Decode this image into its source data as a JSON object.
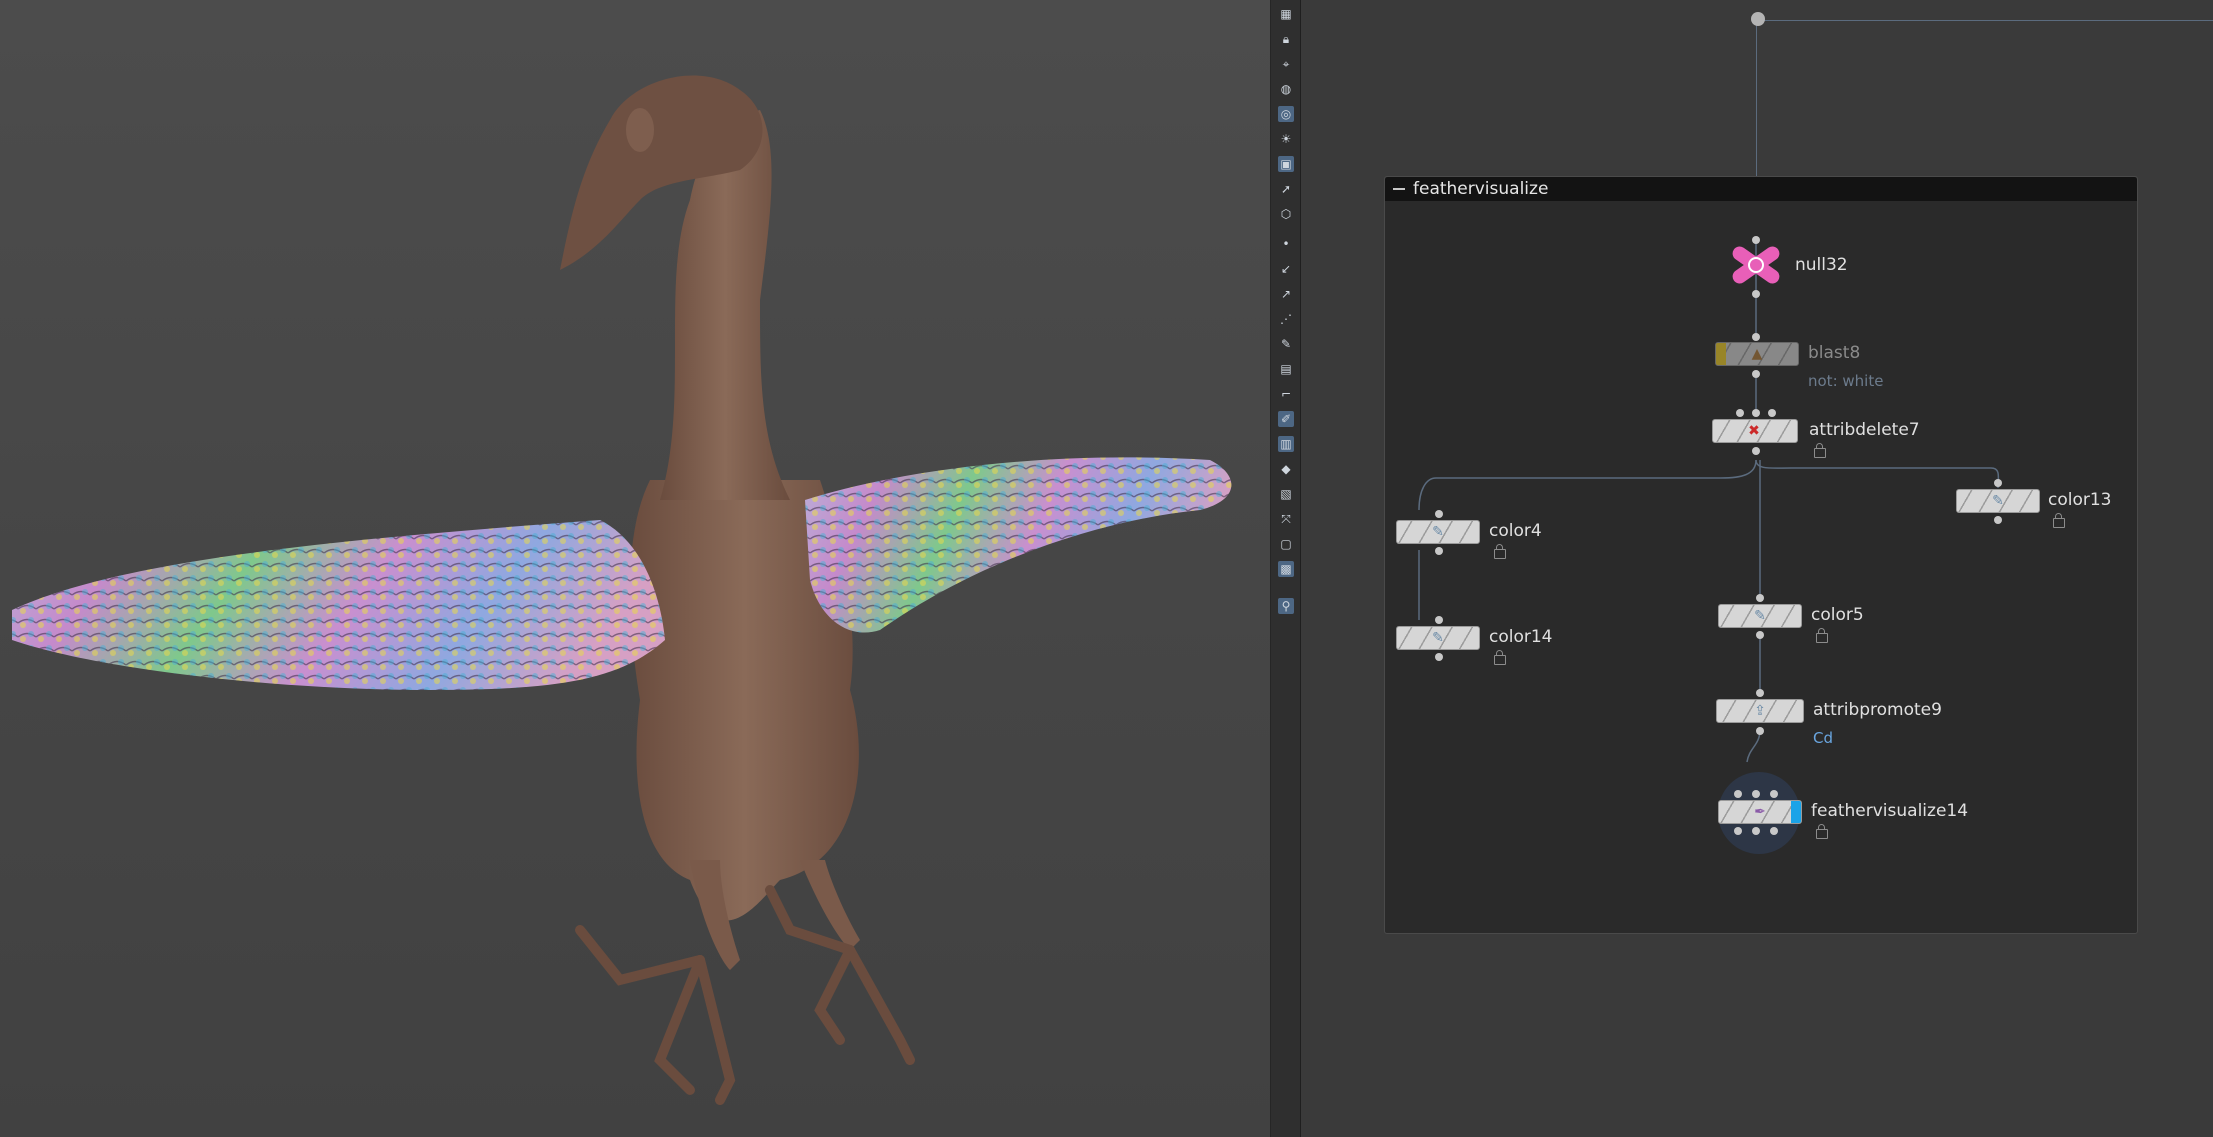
{
  "viewport": {
    "scene_icon": "bird-model-with-colored-feathers",
    "body_color": "#7a5a4a"
  },
  "toolbar": {
    "icons": [
      "display-options-icon",
      "lock-icon",
      "snap-icon",
      "shading-icon",
      "wireframe-icon",
      "light-icon",
      "camera-icon",
      "select-icon",
      "geometry-icon",
      "point-icon",
      "edge-icon",
      "primitive-icon",
      "vertex-icon",
      "brush-icon",
      "paint-icon",
      "corner-icon",
      "highlight-icon",
      "ghost-icon",
      "reference-icon",
      "template-icon",
      "flip-icon",
      "background-icon",
      "camera-view-icon",
      "pin-icon"
    ]
  },
  "network": {
    "subnet_title": "feathervisualize",
    "nodes": {
      "null32": {
        "label": "null32"
      },
      "blast8": {
        "label": "blast8",
        "sub": "not: white"
      },
      "attribdelete7": {
        "label": "attribdelete7"
      },
      "color4": {
        "label": "color4"
      },
      "color14": {
        "label": "color14"
      },
      "color13": {
        "label": "color13"
      },
      "color5": {
        "label": "color5"
      },
      "attribpromote9": {
        "label": "attribpromote9",
        "sub": "Cd"
      },
      "feathervisualize14": {
        "label": "feathervisualize14"
      }
    },
    "colors": {
      "null_node": "#e85fb8",
      "bypass_flag": "#f2d128",
      "display_flag": "#1aa3e8",
      "wire": "#5b6b7e",
      "sub_blue": "#6aa6e0",
      "sub_grey": "#6c7b8c"
    }
  }
}
